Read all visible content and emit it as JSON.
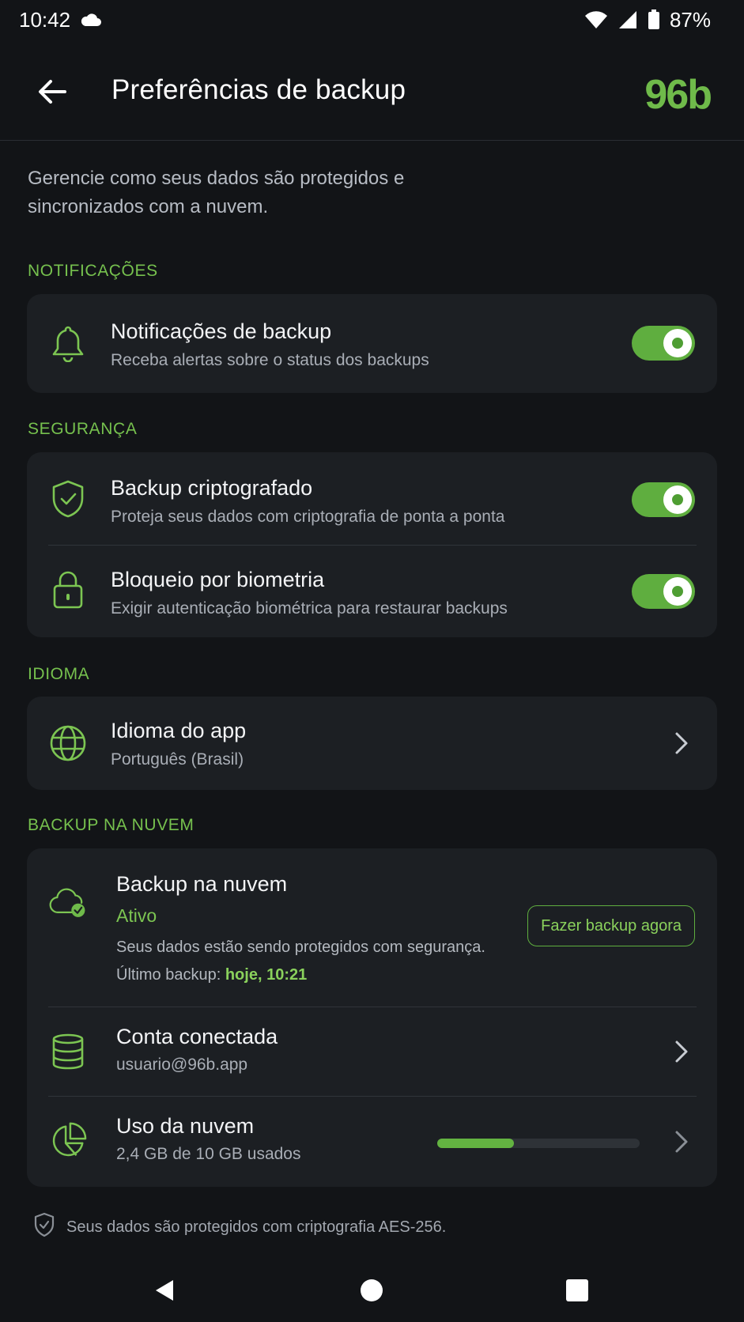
{
  "status_bar": {
    "time": "10:42",
    "battery_percent": "87%",
    "icons": [
      "cloud-icon",
      "wifi-icon",
      "signal-icon",
      "battery-icon"
    ]
  },
  "app_bar": {
    "title": "Preferências de backup",
    "logo": "96b"
  },
  "intro": "Gerencie como seus dados são protegidos e sincronizados com a nuvem.",
  "sections": {
    "notifications": {
      "label": "NOTIFICAÇÕES",
      "items": [
        {
          "title": "Notificações de backup",
          "subtitle": "Receba alertas sobre o status dos backups",
          "icon": "bell-icon",
          "toggle_on": true
        }
      ]
    },
    "security": {
      "label": "SEGURANÇA",
      "items": [
        {
          "title": "Backup criptografado",
          "subtitle": "Proteja seus dados com criptografia de ponta a ponta",
          "icon": "shield-check-icon",
          "toggle_on": true
        },
        {
          "title": "Bloqueio por biometria",
          "subtitle": "Exigir autenticação biométrica para restaurar backups",
          "icon": "lock-icon",
          "toggle_on": true
        }
      ]
    },
    "language": {
      "label": "IDIOMA",
      "items": [
        {
          "title": "Idioma do app",
          "subtitle": "Português (Brasil)",
          "icon": "globe-icon"
        }
      ]
    },
    "cloud": {
      "label": "BACKUP NA NUVEM",
      "backup": {
        "title": "Backup na nuvem",
        "status": "Ativo",
        "description": "Seus dados estão sendo protegidos com segurança.",
        "last_backup_label": "Último backup:",
        "last_backup_value": "hoje, 10:21",
        "button_label": "Fazer backup agora",
        "icon": "cloud-check-icon"
      },
      "account": {
        "title": "Conta conectada",
        "subtitle": "usuario@96b.app",
        "icon": "database-icon"
      },
      "usage": {
        "title": "Uso da nuvem",
        "subtitle": "2,4 GB de 10 GB usados",
        "used_fraction": 0.38,
        "icon": "pie-chart-icon"
      }
    }
  },
  "footer_note": "Seus dados são protegidos com criptografia AES-256.",
  "colors": {
    "background": "#121417",
    "card": "#1c1f23",
    "accent": "#6fba4a",
    "toggle_on": "#5fae3f"
  }
}
